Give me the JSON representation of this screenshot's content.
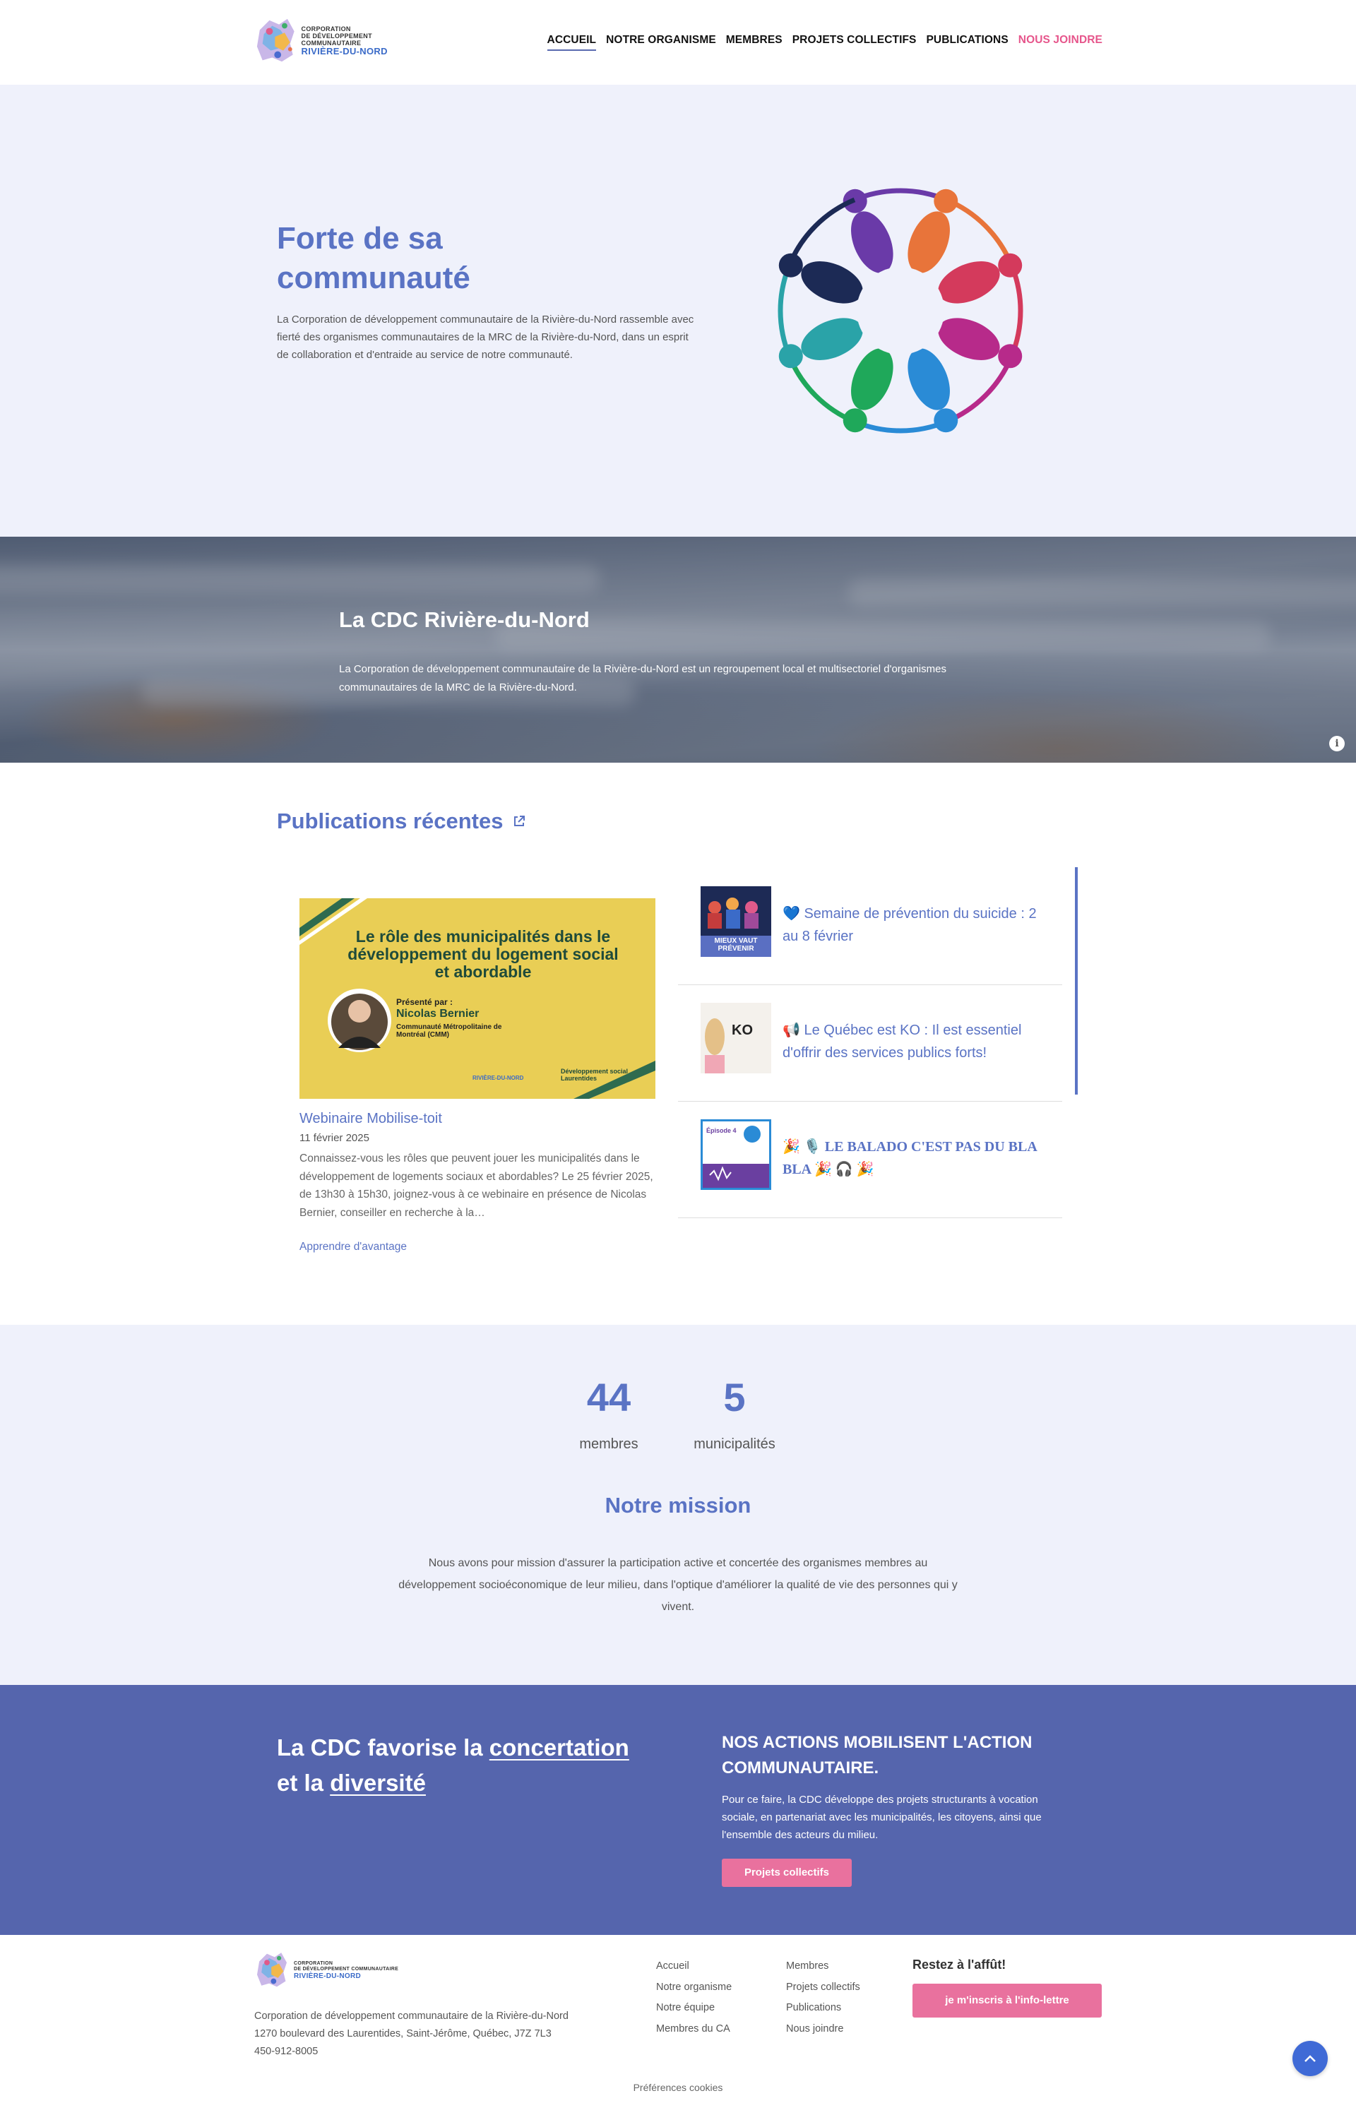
{
  "header": {
    "logo": {
      "line1": "CORPORATION",
      "line2": "DE DÉVELOPPEMENT COMMUNAUTAIRE",
      "line3": "RIVIÈRE-DU-NORD"
    },
    "nav": [
      {
        "label": "ACCUEIL"
      },
      {
        "label": "NOTRE ORGANISME"
      },
      {
        "label": "MEMBRES"
      },
      {
        "label": "PROJETS COLLECTIFS"
      },
      {
        "label": "PUBLICATIONS"
      },
      {
        "label": "NOUS JOINDRE"
      }
    ]
  },
  "hero": {
    "title": "Forte de sa communauté",
    "text": "La Corporation de développement communautaire de la Rivière-du-Nord rassemble avec fierté des organismes communautaires de la MRC de la Rivière-du-Nord, dans un esprit de collaboration et d'entraide au service de notre communauté."
  },
  "banner": {
    "title": "La CDC Rivière-du-Nord",
    "text": "La Corporation de développement communautaire de la Rivière-du-Nord est un regroupement local et multisectoriel d'organismes communautaires de la MRC de la Rivière-du-Nord.",
    "info_icon": "i"
  },
  "publications": {
    "title": "Publications récentes",
    "featured": {
      "image": {
        "headline": "Le rôle des municipalités dans le développement du logement social et abordable",
        "presenter_label": "Présenté par :",
        "presenter_name": "Nicolas Bernier",
        "presenter_org": "Communauté Métropolitaine de Montréal (CMM)",
        "partner_1": "RIVIÈRE-DU-NORD",
        "partner_2": "Développement social Laurentides"
      },
      "title": "Webinaire Mobilise-toit",
      "date": "11 février 2025",
      "text": "Connaissez-vous les rôles que peuvent jouer les municipalités dans le développement de logements sociaux et abordables? Le 25 février 2025, de 13h30 à 15h30, joignez-vous à ce webinaire en présence de Nicolas Bernier, conseiller en recherche à la…",
      "more": "Apprendre d'avantage"
    },
    "items": [
      {
        "title": "💙 Semaine de prévention du suicide : 2 au 8 février",
        "thumb_text": "MIEUX VAUT PRÉVENIR"
      },
      {
        "title": "📢 Le Québec est KO : Il est essentiel d'offrir des services publics forts!",
        "thumb_text": "KO"
      },
      {
        "title": "🎉 🎙️ LE BALADO C'EST PAS DU BLA BLA 🎉 🎧 🎉",
        "thumb_text": "Épisode 4"
      }
    ]
  },
  "stats": [
    {
      "value": "44",
      "label": "membres"
    },
    {
      "value": "5",
      "label": "municipalités"
    }
  ],
  "mission": {
    "title": "Notre mission",
    "text": "Nous avons pour mission d'assurer la participation active et concertée des organismes membres au développement socioéconomique de leur milieu, dans l'optique d'améliorer la qualité de vie des personnes qui y vivent."
  },
  "cta": {
    "head_pre": "La CDC favorise la ",
    "head_u1": "concertation",
    "head_mid": " et la ",
    "head_u2": "diversité",
    "h2": "NOS ACTIONS MOBILISENT L'ACTION COMMUNAUTAIRE.",
    "text": "Pour ce faire, la CDC développe des projets structurants à vocation sociale, en partenariat avec les municipalités, les citoyens, ainsi que l'ensemble des acteurs du milieu.",
    "button": "Projets collectifs"
  },
  "footer": {
    "address": [
      "Corporation de développement communautaire de la Rivière-du-Nord",
      "1270 boulevard des Laurentides, Saint-Jérôme, Québec, J7Z 7L3",
      "450-912-8005"
    ],
    "col1": [
      "Accueil",
      "Notre organisme",
      "Notre équipe",
      "Membres du CA"
    ],
    "col2": [
      "Membres",
      "Projets collectifs",
      "Publications",
      "Nous joindre"
    ],
    "newsletter_title": "Restez à l'affût!",
    "newsletter_button": "je m'inscris à l'info-lettre",
    "cookies": "Préférences cookies"
  },
  "colors": {
    "primary": "#5a73c4",
    "accent": "#e6558b",
    "band": "#5565ad",
    "light_bg": "#eff1fb"
  }
}
